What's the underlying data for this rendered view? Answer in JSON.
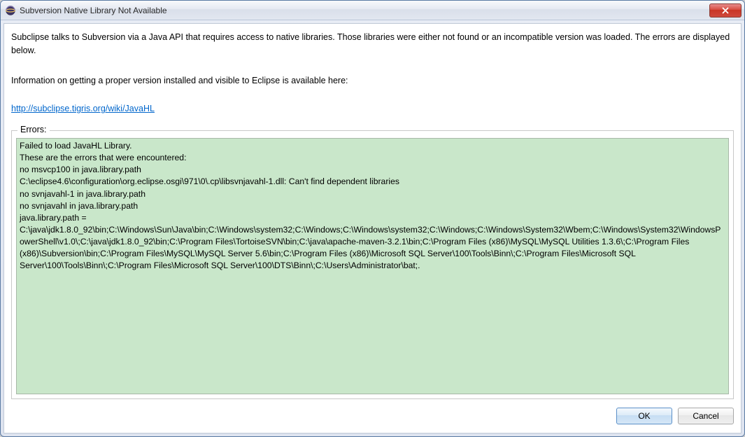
{
  "titlebar": {
    "title": "Subversion Native Library Not Available"
  },
  "content": {
    "description": "Subclipse talks to Subversion via a Java API that requires access to native libraries. Those libraries were either not found or an incompatible version was loaded.  The errors are displayed below.",
    "info": "Information on getting a proper version installed and visible to Eclipse is available here:",
    "link": "http://subclipse.tigris.org/wiki/JavaHL",
    "errors_label": "Errors:",
    "errors_text": "Failed to load JavaHL Library.\nThese are the errors that were encountered:\nno msvcp100 in java.library.path\nC:\\eclipse4.6\\configuration\\org.eclipse.osgi\\971\\0\\.cp\\libsvnjavahl-1.dll: Can't find dependent libraries\nno svnjavahl-1 in java.library.path\nno svnjavahl in java.library.path\njava.library.path = C:\\java\\jdk1.8.0_92\\bin;C:\\Windows\\Sun\\Java\\bin;C:\\Windows\\system32;C:\\Windows;C:\\Windows\\system32;C:\\Windows;C:\\Windows\\System32\\Wbem;C:\\Windows\\System32\\WindowsPowerShell\\v1.0\\;C:\\java\\jdk1.8.0_92\\bin;C:\\Program Files\\TortoiseSVN\\bin;C:\\java\\apache-maven-3.2.1\\bin;C:\\Program Files (x86)\\MySQL\\MySQL Utilities 1.3.6\\;C:\\Program Files (x86)\\Subversion\\bin;C:\\Program Files\\MySQL\\MySQL Server 5.6\\bin;C:\\Program Files (x86)\\Microsoft SQL Server\\100\\Tools\\Binn\\;C:\\Program Files\\Microsoft SQL Server\\100\\Tools\\Binn\\;C:\\Program Files\\Microsoft SQL Server\\100\\DTS\\Binn\\;C:\\Users\\Administrator\\bat;."
  },
  "buttons": {
    "ok": "OK",
    "cancel": "Cancel"
  }
}
